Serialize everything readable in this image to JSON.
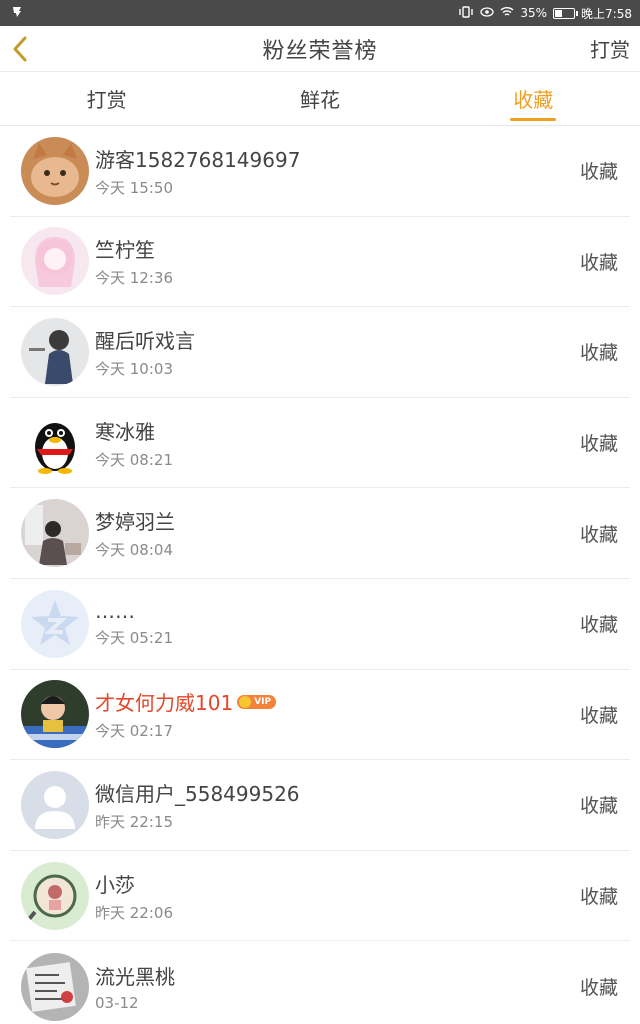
{
  "status_bar": {
    "battery": "35%",
    "battery_level": 0.35,
    "time": "晚上7:58"
  },
  "header": {
    "title": "粉丝荣誉榜",
    "right_action": "打赏"
  },
  "tabs": [
    {
      "label": "打赏",
      "active": false
    },
    {
      "label": "鲜花",
      "active": false
    },
    {
      "label": "收藏",
      "active": true
    }
  ],
  "fans": [
    {
      "name": "游客1582768149697",
      "time": "今天 15:50",
      "action": "收藏",
      "avatar": "cat-photo"
    },
    {
      "name": "竺柠笙",
      "time": "今天 12:36",
      "action": "收藏",
      "avatar": "anime-girl"
    },
    {
      "name": "醒后听戏言",
      "time": "今天 10:03",
      "action": "收藏",
      "avatar": "girl-back"
    },
    {
      "name": "寒冰雅",
      "time": "今天 08:21",
      "action": "收藏",
      "avatar": "qq-penguin"
    },
    {
      "name": "梦婷羽兰",
      "time": "今天 08:04",
      "action": "收藏",
      "avatar": "girl-window"
    },
    {
      "name": "……",
      "time": "今天 05:21",
      "action": "收藏",
      "avatar": "qzone-star"
    },
    {
      "name": "才女何力威101",
      "time": "今天 02:17",
      "action": "收藏",
      "avatar": "kids-photo",
      "vip": true,
      "vip_label": "VIP"
    },
    {
      "name": "微信用户_558499526",
      "time": "昨天 22:15",
      "action": "收藏",
      "avatar": "default-user"
    },
    {
      "name": "小莎",
      "time": "昨天 22:06",
      "action": "收藏",
      "avatar": "magnifier-photo"
    },
    {
      "name": "流光黑桃",
      "time": "03-12",
      "action": "收藏",
      "avatar": "paper-photo"
    }
  ],
  "colors": {
    "accent": "#f0a020",
    "vip_name": "#e4472a",
    "status_bar_bg": "#4a4a4a"
  }
}
